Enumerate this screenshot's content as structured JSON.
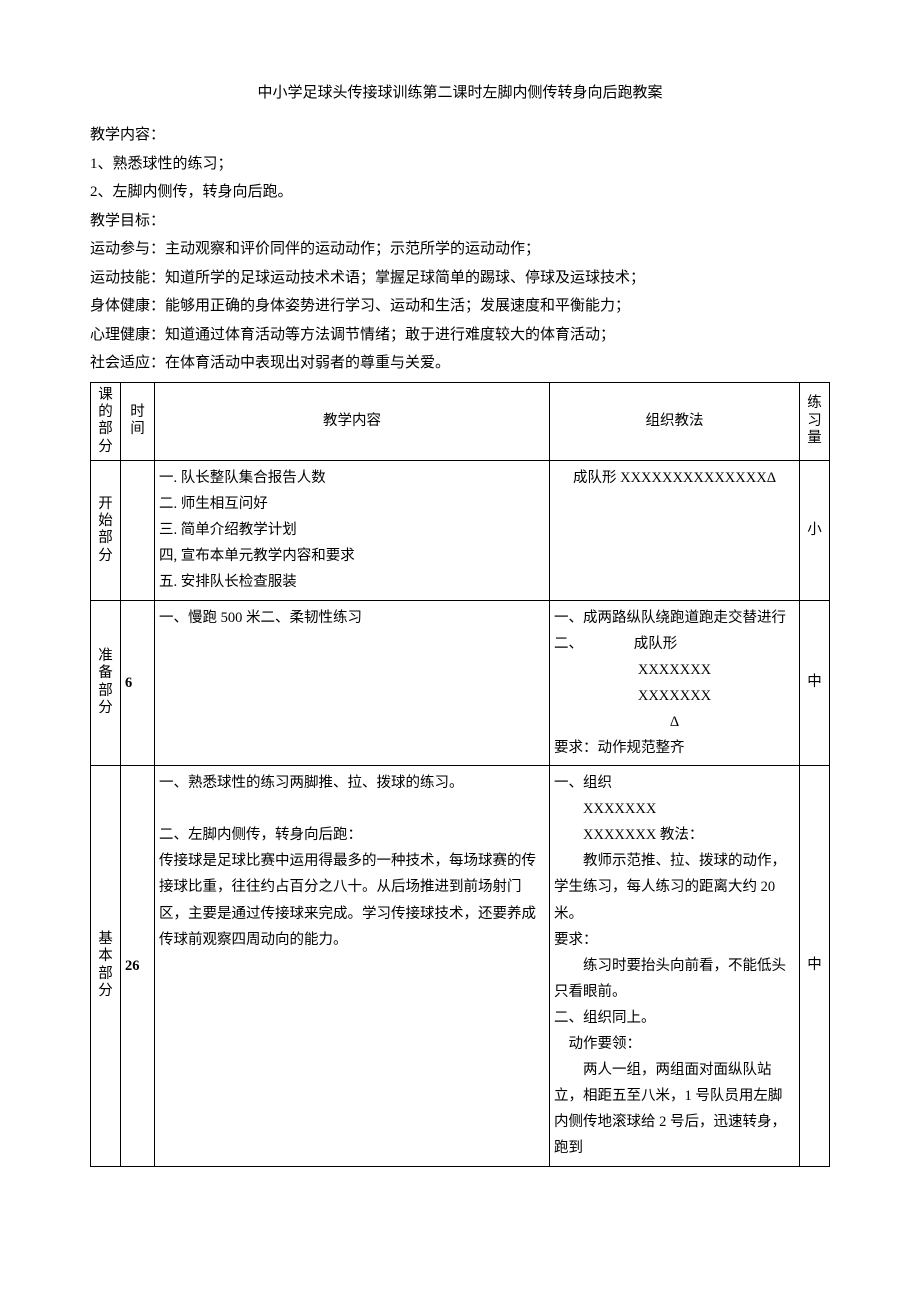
{
  "title": "中小学足球头传接球训练第二课时左脚内侧传转身向后跑教案",
  "intro": {
    "content_label": "教学内容：",
    "content_1": "1、熟悉球性的练习；",
    "content_2": "2、左脚内侧传，转身向后跑。",
    "goal_label": "教学目标：",
    "g1": "运动参与：主动观察和评价同伴的运动动作；示范所学的运动动作；",
    "g2": "运动技能：知道所学的足球运动技术术语；掌握足球简单的踢球、停球及运球技术；",
    "g3": "身体健康：能够用正确的身体姿势进行学习、运动和生活；发展速度和平衡能力；",
    "g4": "心理健康：知道通过体育活动等方法调节情绪；敢于进行难度较大的体育活动；",
    "g5": "社会适应：在体育活动中表现出对弱者的尊重与关爱。"
  },
  "headers": {
    "part": "课的部分",
    "time": "时间",
    "content": "教学内容",
    "method": "组织教法",
    "load": "练习量"
  },
  "rows": {
    "start": {
      "part": "开始部分",
      "time": "",
      "content_lines": [
        "一. 队长整队集合报告人数",
        "二. 师生相互问好",
        "三. 简单介绍教学计划",
        "四, 宣布本单元教学内容和要求",
        "五. 安排队长检查服装"
      ],
      "method_line1": "成队形 XXXXXXXXXXXXXXΔ",
      "load": "小"
    },
    "prep": {
      "part": "准备部分",
      "time": "6",
      "content_line": "一、慢跑 500 米二、柔韧性练习",
      "method_lines": [
        "一、成两路纵队绕跑道跑走交替进行",
        "二、　　　　成队形",
        "XXXXXXX",
        "XXXXXXX",
        "Δ",
        "要求：动作规范整齐"
      ],
      "load": "中"
    },
    "base": {
      "part": "基本部分",
      "time": "26",
      "content_p1": "一、熟悉球性的练习两脚推、拉、拨球的练习。",
      "content_p2": "二、左脚内侧传，转身向后跑：",
      "content_p3": "传接球是足球比赛中运用得最多的一种技术，每场球赛的传接球比重，往往约占百分之八十。从后场推进到前场射门区，主要是通过传接球来完成。学习传接球技术，还要养成传球前观察四周动向的能力。",
      "method_lines": [
        "一、组织",
        "　　XXXXXXX",
        "　　XXXXXXX 教法：",
        "　　教师示范推、拉、拨球的动作，学生练习，每人练习的距离大约 20米。",
        "要求：",
        "　　练习时要抬头向前看，不能低头只看眼前。",
        "二、组织同上。",
        "　动作要领：",
        "　　两人一组，两组面对面纵队站立，相距五至八米，1 号队员用左脚内侧传地滚球给 2 号后，迅速转身，跑到"
      ],
      "load": "中"
    }
  }
}
